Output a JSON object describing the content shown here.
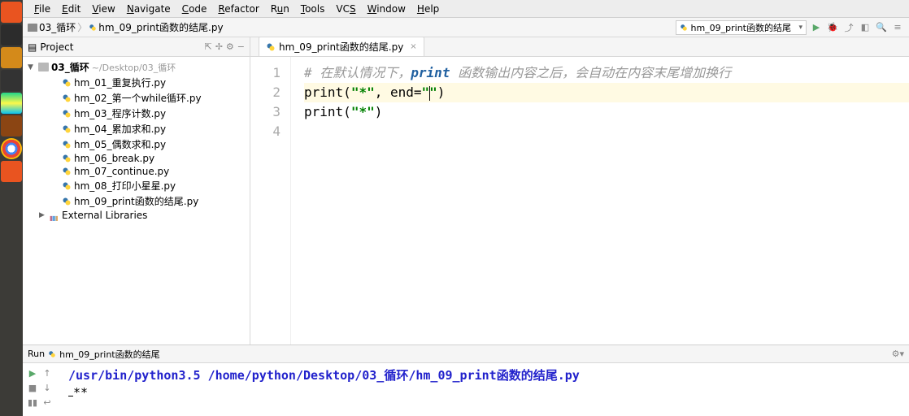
{
  "menubar": [
    "File",
    "Edit",
    "View",
    "Navigate",
    "Code",
    "Refactor",
    "Run",
    "Tools",
    "VCS",
    "Window",
    "Help"
  ],
  "breadcrumb": {
    "folder": "03_循环",
    "file": "hm_09_print函数的结尾.py"
  },
  "run_config": "hm_09_print函数的结尾",
  "sidebar": {
    "title": "Project",
    "root": "03_循环",
    "root_path": "~/Desktop/03_循环",
    "files": [
      "hm_01_重复执行.py",
      "hm_02_第一个while循环.py",
      "hm_03_程序计数.py",
      "hm_04_累加求和.py",
      "hm_05_偶数求和.py",
      "hm_06_break.py",
      "hm_07_continue.py",
      "hm_08_打印小星星.py",
      "hm_09_print函数的结尾.py"
    ],
    "external": "External Libraries"
  },
  "tab": {
    "label": "hm_09_print函数的结尾.py"
  },
  "code": {
    "lines": [
      "1",
      "2",
      "3",
      "4"
    ],
    "comment_prefix": "# ",
    "comment_text_a": "在默认情况下，",
    "comment_kw": "print",
    "comment_text_b": " 函数输出内容之后，会自动在内容末尾增加换行",
    "line2_a": "print",
    "line2_par_o": "(",
    "line2_str1": "\"*\"",
    "line2_comma": ", ",
    "line2_end": "end=",
    "line2_str2a": "\"",
    "line2_str2b": "\"",
    "line2_par_c": ")",
    "line3_a": "print",
    "line3_par_o": "(",
    "line3_str": "\"*\"",
    "line3_par_c": ")"
  },
  "run": {
    "label": "Run",
    "config": "hm_09_print函数的结尾",
    "interpreter": "/usr/bin/python3.5",
    "script": "/home/python/Desktop/03_循环/hm_09_print函数的结尾.py",
    "output": "**"
  }
}
